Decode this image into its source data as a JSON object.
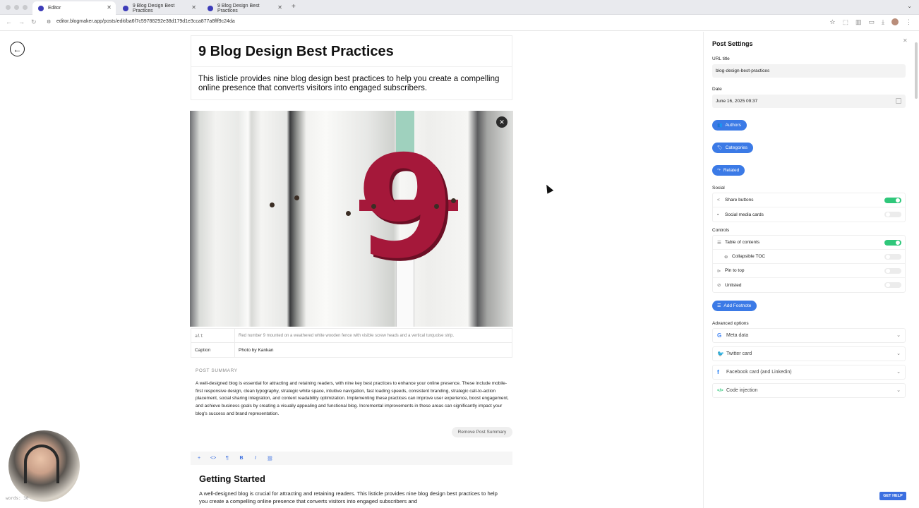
{
  "browser": {
    "tabs": [
      {
        "label": "Editor"
      },
      {
        "label": "9 Blog Design Best Practices"
      },
      {
        "label": "9 Blog Design Best Practices"
      }
    ],
    "url": "editor.blogmaker.app/posts/edit/ba6f7c59788292e38d179d1e3cca877a8fff9c24da"
  },
  "editor": {
    "title": "9 Blog Design Best Practices",
    "subtitle": "This listicle provides nine blog design best practices to help you create a compelling online presence that converts visitors into engaged subscribers.",
    "image": {
      "alt_key": "alt",
      "alt_value": "Red number 9 mounted on a weathered white wooden fence with visible screw heads and a vertical turquoise strip.",
      "caption_key": "Caption",
      "caption_value": "Photo by Kankan"
    },
    "post_summary_label": "POST SUMMARY",
    "post_summary": "A well-designed blog is essential for attracting and retaining readers, with nine key best practices to enhance your online presence. These include mobile-first responsive design, clean typography, strategic white space, intuitive navigation, fast loading speeds, consistent branding, strategic call-to-action placement, social sharing integration, and content readability optimization. Implementing these practices can improve user experience, boost engagement, and achieve business goals by creating a visually appealing and functional blog. Incremental improvements in these areas can significantly impact your blog's success and brand representation.",
    "remove_summary": "Remove Post Summary",
    "toolbar": [
      "+",
      "<>",
      "¶",
      "B",
      "I",
      "⛓"
    ],
    "heading": "Getting Started",
    "body": "A well-designed blog is crucial for attracting and retaining readers. This listicle provides nine blog design best practices to help you create a compelling online presence that converts visitors into engaged subscribers and",
    "words_label": "words: 30"
  },
  "settings": {
    "title": "Post Settings",
    "url_title_label": "URL title",
    "url_title_value": "blog-design-best-practices",
    "date_label": "Date",
    "date_value": "June 16, 2025 09:37",
    "authors": "Authors",
    "categories": "Categories",
    "related": "Related",
    "social_label": "Social",
    "social": [
      {
        "label": "Share buttons",
        "on": true
      },
      {
        "label": "Social media cards",
        "on": false
      }
    ],
    "controls_label": "Controls",
    "controls": [
      {
        "label": "Table of contents",
        "on": true
      },
      {
        "label": "Collapsible TOC",
        "on": false
      },
      {
        "label": "Pin to top",
        "on": false
      },
      {
        "label": "Unlisted",
        "on": false
      }
    ],
    "add_footnote": "Add Footnote",
    "advanced_label": "Advanced options",
    "advanced": [
      {
        "label": "Meta data",
        "icon": "G",
        "color": "#4285f4"
      },
      {
        "label": "Twitter card",
        "icon": "🐦",
        "color": "#1d9bf0"
      },
      {
        "label": "Facebook card (and Linkedin)",
        "icon": "f",
        "color": "#1877f2"
      },
      {
        "label": "Code injection",
        "icon": "</>",
        "color": "#2fc77a"
      }
    ],
    "get_help": "GET HELP"
  }
}
